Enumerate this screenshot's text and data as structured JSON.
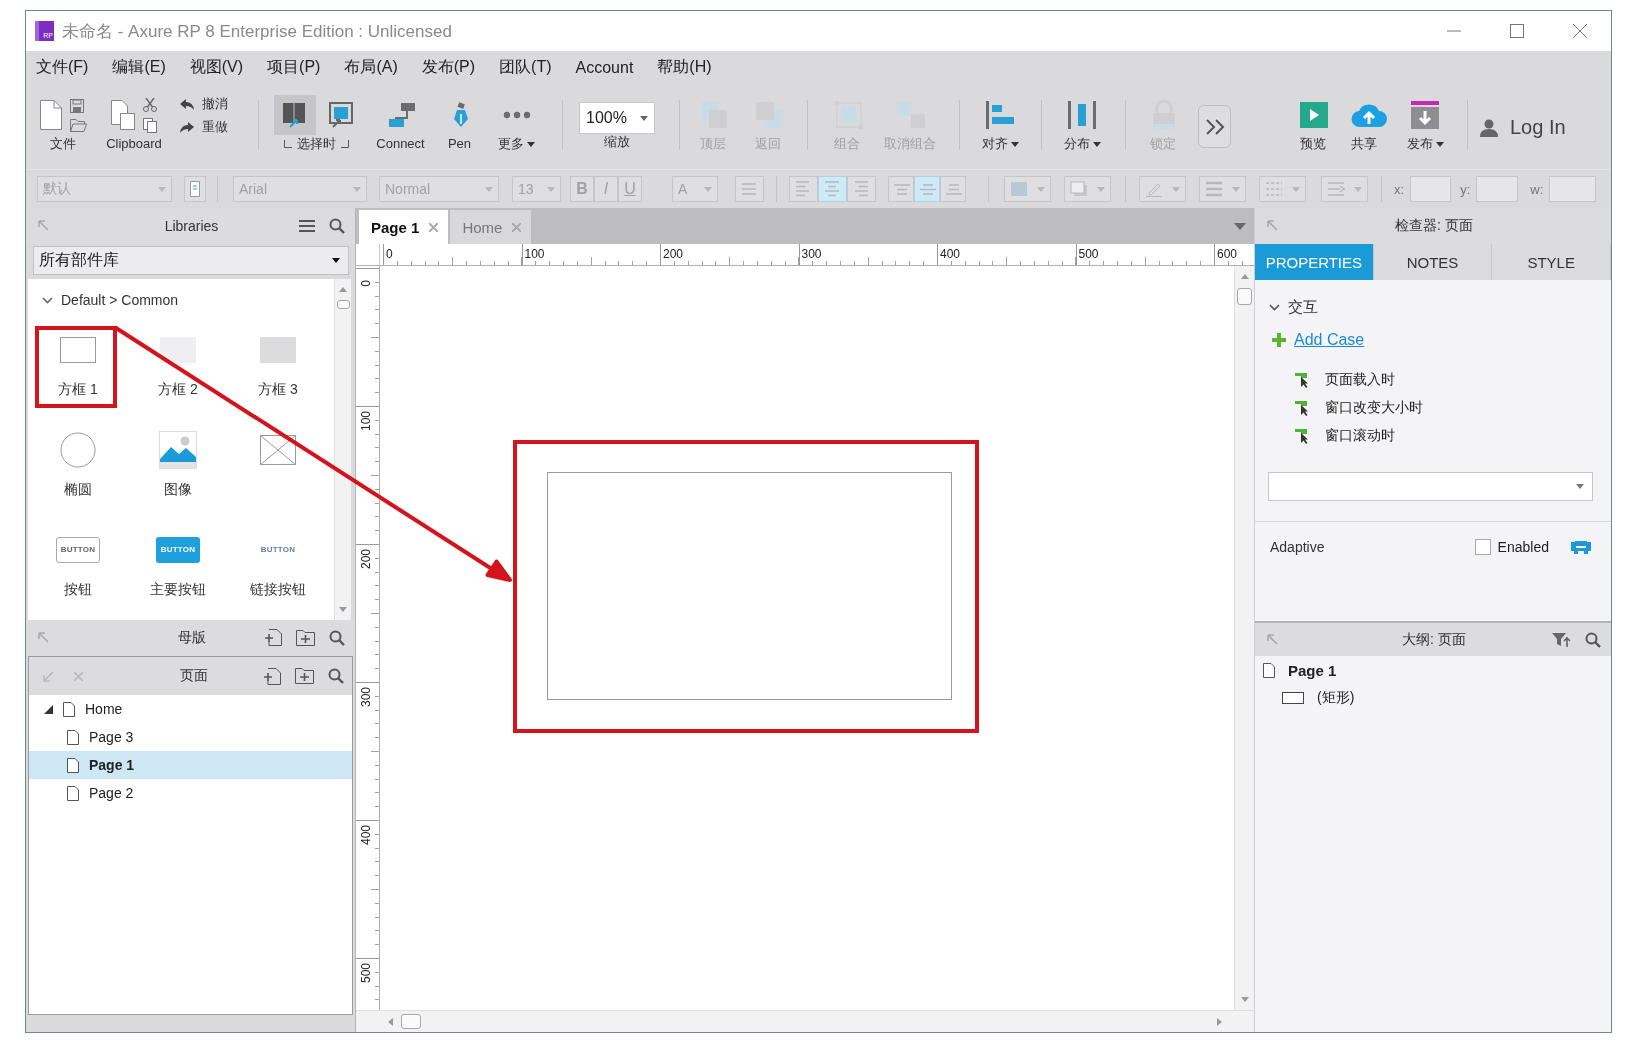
{
  "window": {
    "logo": "RP",
    "title": "未命名 - Axure RP 8 Enterprise Edition : Unlicensed"
  },
  "menu": [
    "文件(F)",
    "编辑(E)",
    "视图(V)",
    "项目(P)",
    "布局(A)",
    "发布(P)",
    "团队(T)",
    "Account",
    "帮助(H)"
  ],
  "toolbar": [
    [
      {
        "kind": "file",
        "label": "文件",
        "disabled": false
      },
      {
        "kind": "clipboard",
        "label": "Clipboard",
        "disabled": false
      },
      {
        "kind": "history",
        "actions": [
          "撤消",
          "重做"
        ],
        "disabled": false
      }
    ],
    [
      {
        "kind": "select",
        "label": "选择时",
        "disabled": false,
        "tools": [
          {
            "selected": true
          },
          {
            "selected": false
          }
        ]
      },
      {
        "kind": "connect",
        "label": "Connect",
        "disabled": false
      },
      {
        "kind": "pen",
        "label": "Pen",
        "disabled": false
      },
      {
        "kind": "more",
        "label": "更多",
        "dropdown": true,
        "disabled": false
      }
    ],
    [
      {
        "kind": "zoom",
        "value": "100%",
        "label": "缩放",
        "disabled": false
      }
    ],
    [
      {
        "kind": "top",
        "label": "顶层",
        "disabled": true
      },
      {
        "kind": "back",
        "label": "返回",
        "disabled": true
      }
    ],
    [
      {
        "kind": "group",
        "label": "组合",
        "disabled": true
      },
      {
        "kind": "ungroup",
        "label": "取消组合",
        "disabled": true
      }
    ],
    [
      {
        "kind": "align",
        "label": "对齐",
        "dropdown": true,
        "disabled": false
      }
    ],
    [
      {
        "kind": "distribute",
        "label": "分布",
        "dropdown": true,
        "disabled": false
      }
    ],
    [
      {
        "kind": "lock",
        "label": "锁定",
        "disabled": true
      },
      {
        "kind": "overflow",
        "disabled": false
      },
      {
        "kind": "preview",
        "label": "预览",
        "disabled": false
      },
      {
        "kind": "share",
        "label": "共享",
        "disabled": false
      },
      {
        "kind": "publish",
        "label": "发布",
        "dropdown": true,
        "disabled": false
      }
    ],
    [
      {
        "kind": "login",
        "label": "Log In",
        "disabled": false
      }
    ]
  ],
  "format_bar": {
    "disabled": true,
    "style": "默认",
    "font": "Arial",
    "weight": "Normal",
    "size": "13",
    "text_styles": [
      "B",
      "I",
      "U"
    ],
    "font_color": "A",
    "align": [
      {
        "selected": false
      },
      {
        "selected": true
      },
      {
        "selected": false
      }
    ],
    "valign": [
      {
        "selected": false
      },
      {
        "selected": true
      },
      {
        "selected": false
      }
    ],
    "coords": [
      "x:",
      "y:",
      "w:"
    ]
  },
  "libraries": {
    "title": "Libraries",
    "filter": "所有部件库",
    "group": "Default > Common",
    "group_expanded": true,
    "widgets": [
      {
        "kind": "box",
        "label": "方框 1"
      },
      {
        "kind": "box-light",
        "label": "方框 2"
      },
      {
        "kind": "box-gray",
        "label": "方框 3"
      },
      {
        "kind": "ellipse",
        "label": "椭圆"
      },
      {
        "kind": "image",
        "label": "图像"
      },
      {
        "kind": "placeholder"
      },
      {
        "kind": "button",
        "label": "按钮",
        "caption": "BUTTON"
      },
      {
        "kind": "primary-button",
        "label": "主要按钮",
        "caption": "BUTTON"
      },
      {
        "kind": "link-button",
        "label": "链接按钮",
        "caption": "BUTTON"
      }
    ]
  },
  "masters": {
    "title": "母版"
  },
  "pages": {
    "title": "页面",
    "tree": [
      {
        "label": "Home",
        "expanded": true,
        "selected": false,
        "children": [
          {
            "label": "Page 3",
            "selected": false
          },
          {
            "label": "Page 1",
            "selected": true
          },
          {
            "label": "Page 2",
            "selected": false
          }
        ]
      }
    ]
  },
  "document_tabs": [
    {
      "label": "Page 1",
      "selected": true
    },
    {
      "label": "Home",
      "selected": false
    }
  ],
  "rulers": {
    "horizontal": [
      "0",
      "100",
      "200",
      "300",
      "400",
      "500",
      "600"
    ],
    "vertical": [
      "0",
      "100",
      "200",
      "300",
      "400",
      "500"
    ]
  },
  "inspector": {
    "title": "检查器: 页面",
    "tabs": [
      {
        "label": "PROPERTIES",
        "selected": true
      },
      {
        "label": "NOTES",
        "selected": false
      },
      {
        "label": "STYLE",
        "selected": false
      }
    ],
    "section": {
      "label": "交互",
      "expanded": true
    },
    "add_case": "Add Case",
    "events": [
      "页面载入时",
      "窗口改变大小时",
      "窗口滚动时"
    ],
    "adaptive": {
      "label": "Adaptive",
      "option": "Enabled",
      "checked": false
    }
  },
  "outline": {
    "title": "大纲: 页面",
    "tree": [
      {
        "label": "Page 1",
        "kind": "page",
        "children": [
          {
            "label": "(矩形)",
            "kind": "shape"
          }
        ]
      }
    ]
  }
}
